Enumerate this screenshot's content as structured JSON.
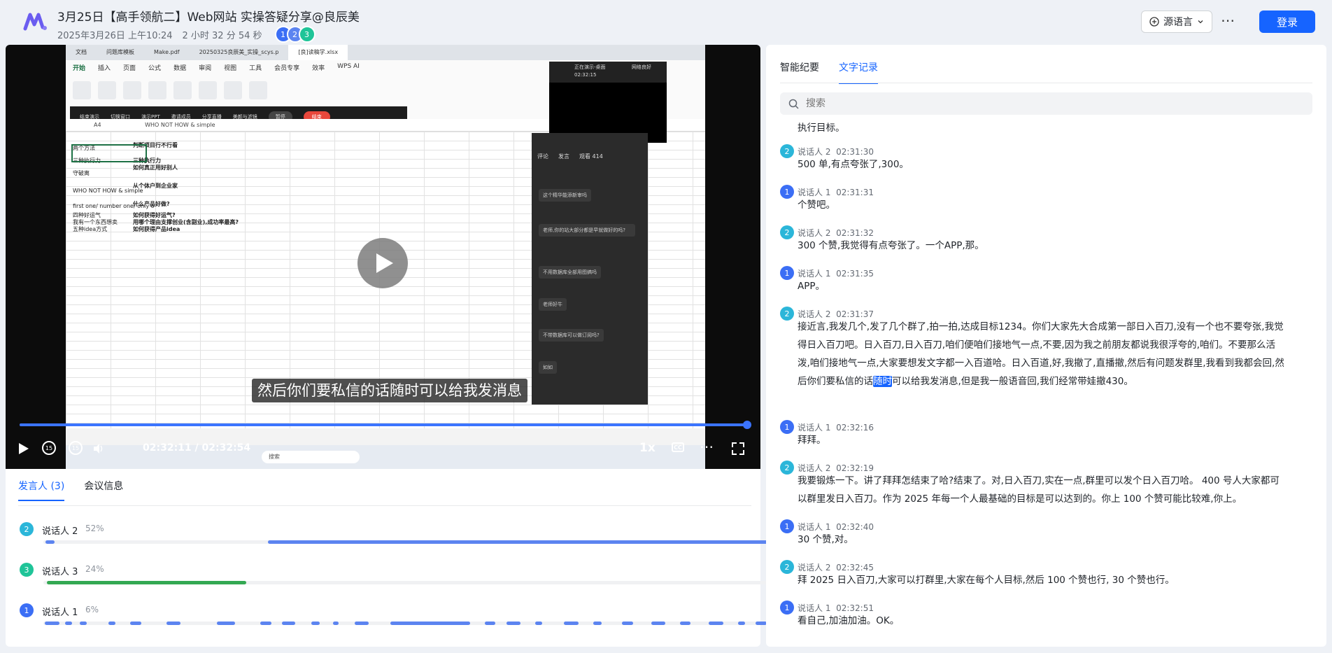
{
  "header": {
    "title": "3月25日【高手领航二】Web网站 实操答疑分享@良辰美",
    "date": "2025年3月26日 上午10:24",
    "duration": "2 小时 32 分 54 秒",
    "avatars": [
      "1",
      "2",
      "3"
    ],
    "lang_label": "源语言",
    "login_label": "登录"
  },
  "video": {
    "browser_tabs": [
      "文档",
      "问题库模板",
      "Make.pdf",
      "20250325良辰美_实操_scys.p",
      "[良]读稿学.xlsx"
    ],
    "ribbon_menu": [
      "开始",
      "插入",
      "页面",
      "公式",
      "数据",
      "审阅",
      "视图",
      "工具",
      "会员专享",
      "效率",
      "WPS AI"
    ],
    "rec_items": [
      "结束演示",
      "切换窗口",
      "演示PPT",
      "邀请成员",
      "分享直播",
      "美颜与滤镜"
    ],
    "rec_pause": "暂停",
    "rec_stop": "结束",
    "cell_ref": "A4",
    "formula_text": "WHO NOT HOW & simple",
    "sheet_rows": [
      {
        "a": "两个方法",
        "b": "判断项目行不行看"
      },
      {
        "a": "三种执行力",
        "b": "三种执行力"
      },
      {
        "a": "守破离",
        "b": "如何真正用好别人"
      },
      {
        "a": "WHO NOT HOW & simple",
        "b": "从个体户到企业家"
      },
      {
        "a": "first one/ number one/ only o",
        "b": "什么产品好做?"
      },
      {
        "a": "四种好运气",
        "b": "如何获得好运气?"
      },
      {
        "a": "我有一个东西想卖",
        "b": "用哪个理由支撑创业(含副业),成功率最高?"
      },
      {
        "a": "五种idea方式",
        "b": "如何获得产品idea"
      }
    ],
    "chat_tabs": [
      "评论",
      "发言",
      "观看 414"
    ],
    "chat_messages": [
      "这个精华能添新审吗",
      "老师,你的站大部分都是早就做好的吗?",
      "不用数据库全部用图搞吗",
      "老师好牛",
      "不带数据库可以做订阅吗?",
      "如如"
    ],
    "preview_label": "正在演示-桌面",
    "preview_time": "02:32:15",
    "preview_net": "网络良好",
    "taskbar_search": "搜索",
    "subtitle": "然后你们要私信的话随时可以给我发消息",
    "current_time": "02:32:11",
    "total_time": "02:32:54",
    "time_display": "02:32:11 / 02:32:54",
    "progress": 0.9973,
    "speed": "1x",
    "skip_back": "15",
    "skip_fwd": "15",
    "cc": "CC"
  },
  "speakers": {
    "tabs": [
      "发言人 (3)",
      "会议信息"
    ],
    "list": [
      {
        "id": "2",
        "name": "说话人 2",
        "pct": "52%",
        "color": "#2bb6d9",
        "bar_color": "#5c84f0"
      },
      {
        "id": "3",
        "name": "说话人 3",
        "pct": "24%",
        "color": "#1fc498",
        "bar_color": "#33a852"
      },
      {
        "id": "1",
        "name": "说话人 1",
        "pct": "6%",
        "color": "#3b6ef5",
        "bar_color": "#5c84f0"
      }
    ]
  },
  "panel": {
    "tabs": [
      "智能纪要",
      "文字记录"
    ],
    "search_placeholder": "搜索",
    "entries": [
      {
        "text": "执行目标。"
      },
      {
        "speaker": "说话人 2",
        "id": "2",
        "time": "02:31:30",
        "text": "500 单,有点夸张了,300。"
      },
      {
        "speaker": "说话人 1",
        "id": "1",
        "time": "02:31:31",
        "text": "个赞吧。"
      },
      {
        "speaker": "说话人 2",
        "id": "2",
        "time": "02:31:32",
        "text": "300 个赞,我觉得有点夸张了。一个APP,那。"
      },
      {
        "speaker": "说话人 1",
        "id": "1",
        "time": "02:31:35",
        "text": "APP。"
      },
      {
        "speaker": "说话人 2",
        "id": "2",
        "time": "02:31:37",
        "text_before": "接近言,我发几个,发了几个群了,拍一拍,达成目标1234。你们大家先大合成第一部日入百刀,没有一个也不要夸张,我觉得日入百刀吧。日入百刀,日入百刀,咱们便咱们接地气一点,不要,因为我之前朋友都说我很浮夸的,咱们。不要那么活泼,咱们接地气一点,大家要想发文字都一入百道哈。日入百道,好,我撤了,直播撤,然后有问题发群里,我看到我都会回,然后你们要私信的话",
        "text_hl": "随时",
        "text_after": "可以给我发消息,但是我一般语音回,我们经常带娃撤430。"
      },
      {
        "speaker": "说话人 1",
        "id": "1",
        "time": "02:32:16",
        "text": "拜拜。"
      },
      {
        "speaker": "说话人 2",
        "id": "2",
        "time": "02:32:19",
        "text": "我要锻炼一下。讲了拜拜怎结束了哈?结束了。对,日入百刀,实在一点,群里可以发个日入百刀哈。 400 号人大家都可以群里发日入百刀。作为 2025 年每一个人最基础的目标是可以达到的。你上 100 个赞可能比较难,你上。"
      },
      {
        "speaker": "说话人 1",
        "id": "1",
        "time": "02:32:40",
        "text": "30 个赞,对。"
      },
      {
        "speaker": "说话人 2",
        "id": "2",
        "time": "02:32:45",
        "text": "拜 2025 日入百刀,大家可以打群里,大家在每个人目标,然后 100 个赞也行, 30 个赞也行。"
      },
      {
        "speaker": "说话人 1",
        "id": "1",
        "time": "02:32:51",
        "text": "看自己,加油加油。OK。"
      }
    ]
  }
}
